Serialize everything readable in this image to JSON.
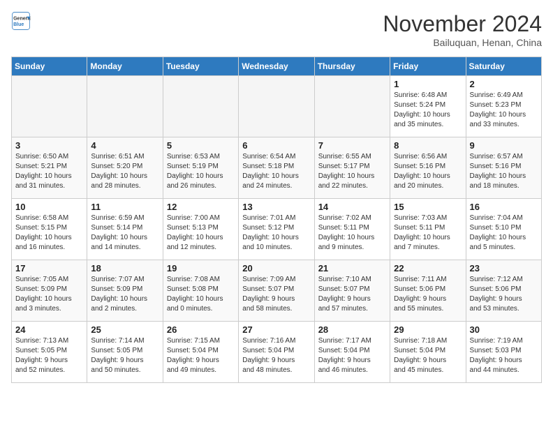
{
  "logo": {
    "line1": "General",
    "line2": "Blue"
  },
  "title": "November 2024",
  "subtitle": "Bailuquan, Henan, China",
  "weekdays": [
    "Sunday",
    "Monday",
    "Tuesday",
    "Wednesday",
    "Thursday",
    "Friday",
    "Saturday"
  ],
  "weeks": [
    [
      {
        "day": "",
        "info": ""
      },
      {
        "day": "",
        "info": ""
      },
      {
        "day": "",
        "info": ""
      },
      {
        "day": "",
        "info": ""
      },
      {
        "day": "",
        "info": ""
      },
      {
        "day": "1",
        "info": "Sunrise: 6:48 AM\nSunset: 5:24 PM\nDaylight: 10 hours\nand 35 minutes."
      },
      {
        "day": "2",
        "info": "Sunrise: 6:49 AM\nSunset: 5:23 PM\nDaylight: 10 hours\nand 33 minutes."
      }
    ],
    [
      {
        "day": "3",
        "info": "Sunrise: 6:50 AM\nSunset: 5:21 PM\nDaylight: 10 hours\nand 31 minutes."
      },
      {
        "day": "4",
        "info": "Sunrise: 6:51 AM\nSunset: 5:20 PM\nDaylight: 10 hours\nand 28 minutes."
      },
      {
        "day": "5",
        "info": "Sunrise: 6:53 AM\nSunset: 5:19 PM\nDaylight: 10 hours\nand 26 minutes."
      },
      {
        "day": "6",
        "info": "Sunrise: 6:54 AM\nSunset: 5:18 PM\nDaylight: 10 hours\nand 24 minutes."
      },
      {
        "day": "7",
        "info": "Sunrise: 6:55 AM\nSunset: 5:17 PM\nDaylight: 10 hours\nand 22 minutes."
      },
      {
        "day": "8",
        "info": "Sunrise: 6:56 AM\nSunset: 5:16 PM\nDaylight: 10 hours\nand 20 minutes."
      },
      {
        "day": "9",
        "info": "Sunrise: 6:57 AM\nSunset: 5:16 PM\nDaylight: 10 hours\nand 18 minutes."
      }
    ],
    [
      {
        "day": "10",
        "info": "Sunrise: 6:58 AM\nSunset: 5:15 PM\nDaylight: 10 hours\nand 16 minutes."
      },
      {
        "day": "11",
        "info": "Sunrise: 6:59 AM\nSunset: 5:14 PM\nDaylight: 10 hours\nand 14 minutes."
      },
      {
        "day": "12",
        "info": "Sunrise: 7:00 AM\nSunset: 5:13 PM\nDaylight: 10 hours\nand 12 minutes."
      },
      {
        "day": "13",
        "info": "Sunrise: 7:01 AM\nSunset: 5:12 PM\nDaylight: 10 hours\nand 10 minutes."
      },
      {
        "day": "14",
        "info": "Sunrise: 7:02 AM\nSunset: 5:11 PM\nDaylight: 10 hours\nand 9 minutes."
      },
      {
        "day": "15",
        "info": "Sunrise: 7:03 AM\nSunset: 5:11 PM\nDaylight: 10 hours\nand 7 minutes."
      },
      {
        "day": "16",
        "info": "Sunrise: 7:04 AM\nSunset: 5:10 PM\nDaylight: 10 hours\nand 5 minutes."
      }
    ],
    [
      {
        "day": "17",
        "info": "Sunrise: 7:05 AM\nSunset: 5:09 PM\nDaylight: 10 hours\nand 3 minutes."
      },
      {
        "day": "18",
        "info": "Sunrise: 7:07 AM\nSunset: 5:09 PM\nDaylight: 10 hours\nand 2 minutes."
      },
      {
        "day": "19",
        "info": "Sunrise: 7:08 AM\nSunset: 5:08 PM\nDaylight: 10 hours\nand 0 minutes."
      },
      {
        "day": "20",
        "info": "Sunrise: 7:09 AM\nSunset: 5:07 PM\nDaylight: 9 hours\nand 58 minutes."
      },
      {
        "day": "21",
        "info": "Sunrise: 7:10 AM\nSunset: 5:07 PM\nDaylight: 9 hours\nand 57 minutes."
      },
      {
        "day": "22",
        "info": "Sunrise: 7:11 AM\nSunset: 5:06 PM\nDaylight: 9 hours\nand 55 minutes."
      },
      {
        "day": "23",
        "info": "Sunrise: 7:12 AM\nSunset: 5:06 PM\nDaylight: 9 hours\nand 53 minutes."
      }
    ],
    [
      {
        "day": "24",
        "info": "Sunrise: 7:13 AM\nSunset: 5:05 PM\nDaylight: 9 hours\nand 52 minutes."
      },
      {
        "day": "25",
        "info": "Sunrise: 7:14 AM\nSunset: 5:05 PM\nDaylight: 9 hours\nand 50 minutes."
      },
      {
        "day": "26",
        "info": "Sunrise: 7:15 AM\nSunset: 5:04 PM\nDaylight: 9 hours\nand 49 minutes."
      },
      {
        "day": "27",
        "info": "Sunrise: 7:16 AM\nSunset: 5:04 PM\nDaylight: 9 hours\nand 48 minutes."
      },
      {
        "day": "28",
        "info": "Sunrise: 7:17 AM\nSunset: 5:04 PM\nDaylight: 9 hours\nand 46 minutes."
      },
      {
        "day": "29",
        "info": "Sunrise: 7:18 AM\nSunset: 5:04 PM\nDaylight: 9 hours\nand 45 minutes."
      },
      {
        "day": "30",
        "info": "Sunrise: 7:19 AM\nSunset: 5:03 PM\nDaylight: 9 hours\nand 44 minutes."
      }
    ]
  ]
}
